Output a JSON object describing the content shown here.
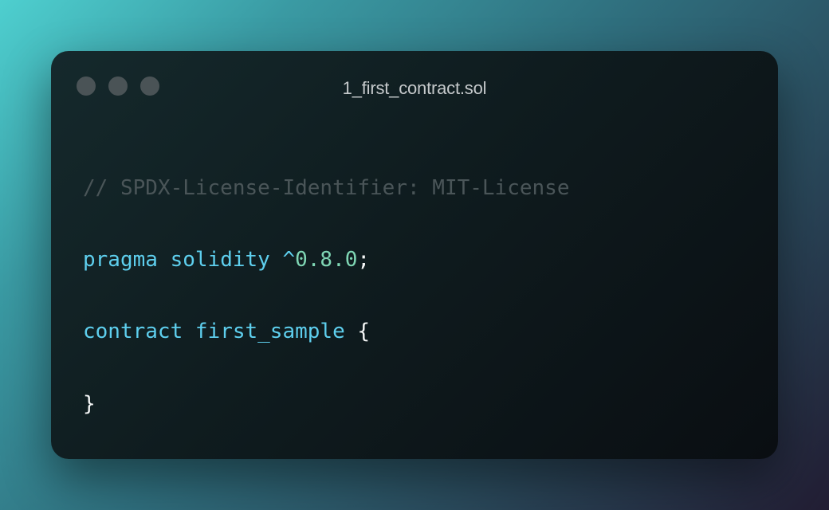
{
  "window": {
    "title": "1_first_contract.sol",
    "controls": [
      "close-dot",
      "minimize-dot",
      "maximize-dot"
    ]
  },
  "code": {
    "line1": {
      "comment": "// SPDX-License-Identifier: MIT-License"
    },
    "line2": {
      "kw1": "pragma",
      "kw2": "solidity",
      "op": "^",
      "version": "0.8.0",
      "end": ";"
    },
    "line3": {
      "kw": "contract",
      "name": "first_sample",
      "brace": "{"
    },
    "line4": {
      "brace": "}"
    }
  },
  "colors": {
    "comment": "#4a5558",
    "keyword": "#5ecfee",
    "number": "#7fd6b4",
    "punctuation": "#f4f6f6",
    "title": "#c5c9cb",
    "dot": "#4a5356"
  }
}
